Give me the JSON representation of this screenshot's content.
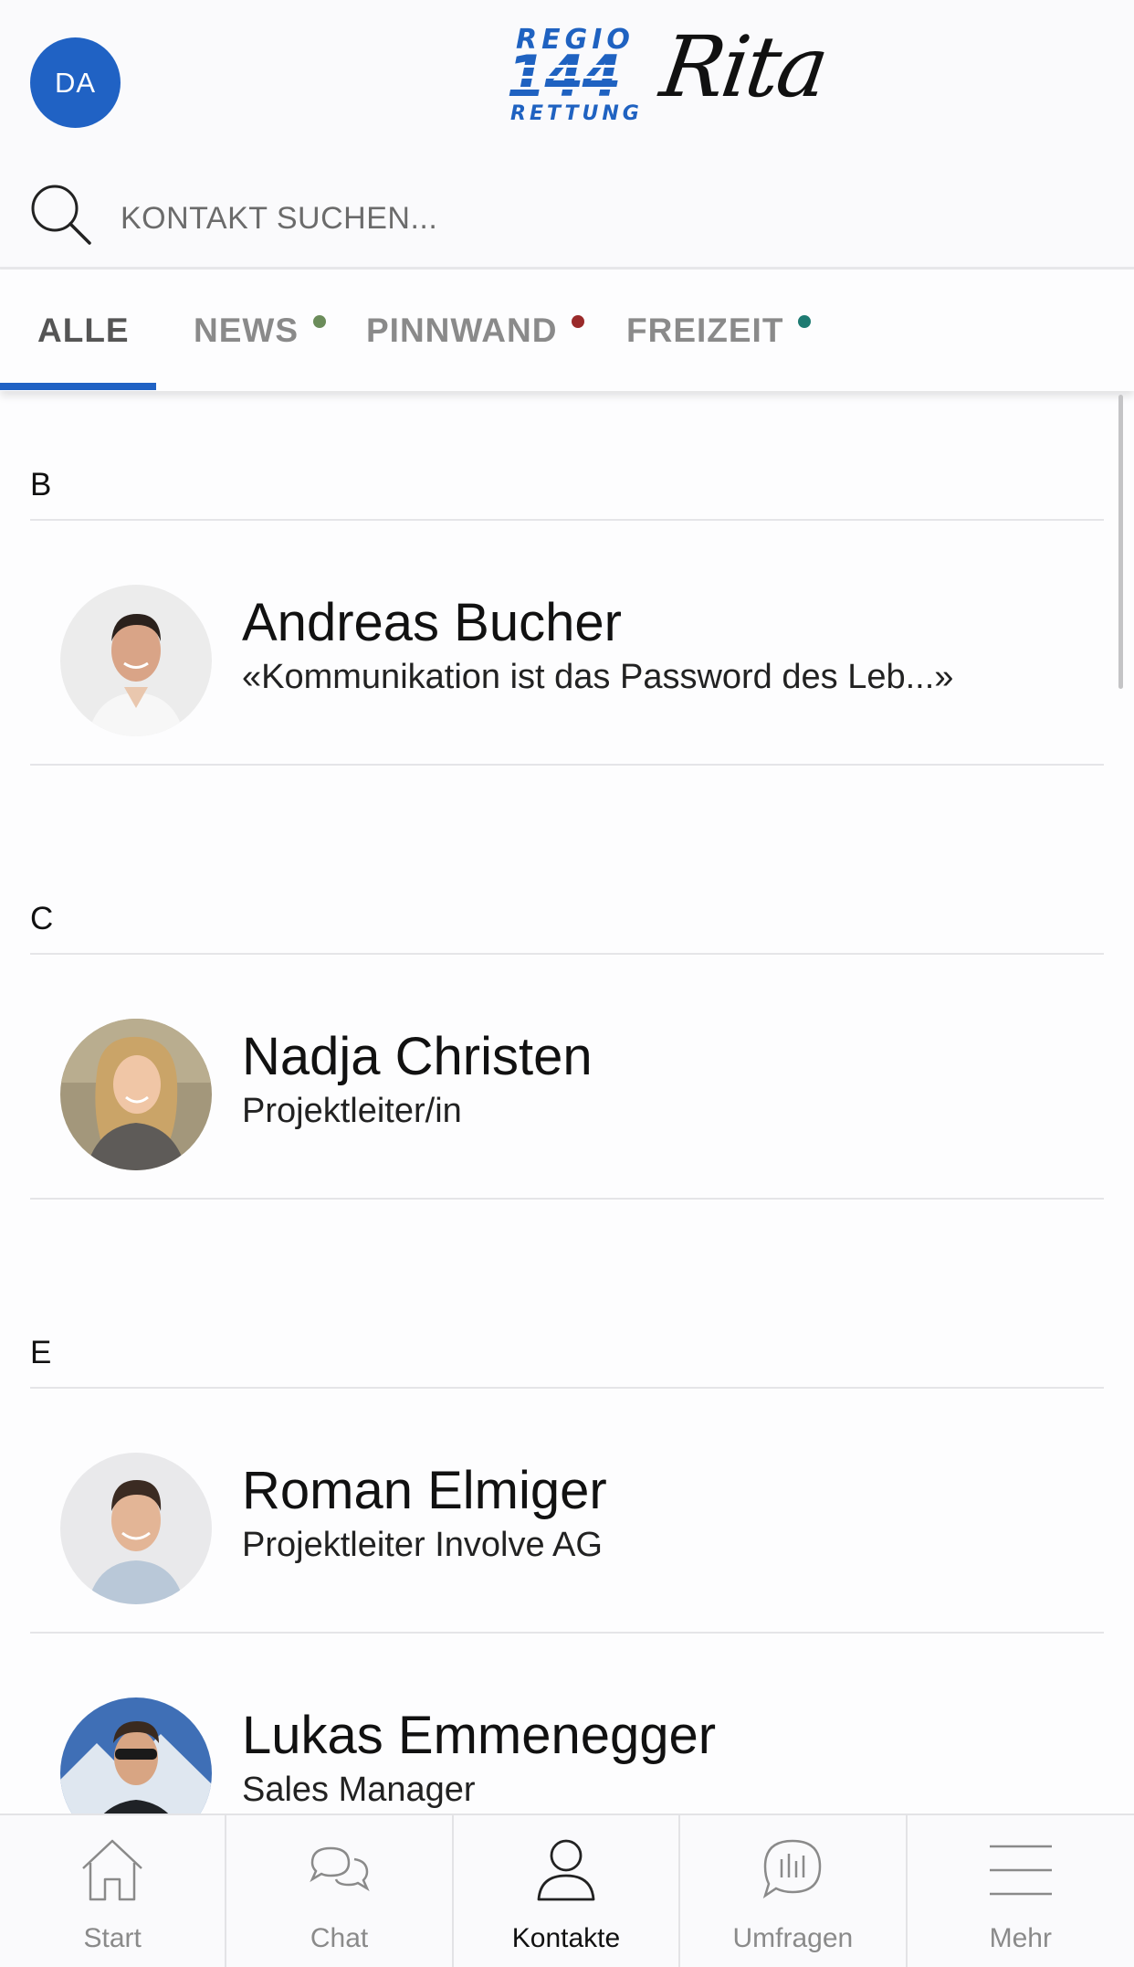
{
  "header": {
    "avatar_initials": "DA",
    "logo": {
      "line1": "REGIO",
      "line2": "144",
      "line3": "RETTUNG",
      "script": "Rita"
    }
  },
  "search": {
    "placeholder": "KONTAKT SUCHEN..."
  },
  "tabs": [
    {
      "label": "ALLE",
      "active": true,
      "dot_color": null
    },
    {
      "label": "NEWS",
      "active": false,
      "dot_color": "#6b8c5a"
    },
    {
      "label": "PINNWAND",
      "active": false,
      "dot_color": "#9a2a2a"
    },
    {
      "label": "FREIZEIT",
      "active": false,
      "dot_color": "#1e7b72"
    }
  ],
  "sections": [
    {
      "letter": "B",
      "contacts": [
        {
          "name": "Andreas Bucher",
          "subtitle": "«Kommunikation ist das Password des Leb...»"
        }
      ]
    },
    {
      "letter": "C",
      "contacts": [
        {
          "name": "Nadja Christen",
          "subtitle": "Projektleiter/in"
        }
      ]
    },
    {
      "letter": "E",
      "contacts": [
        {
          "name": "Roman Elmiger",
          "subtitle": "Projektleiter Involve AG"
        },
        {
          "name": "Lukas Emmenegger",
          "subtitle": "Sales Manager"
        }
      ]
    }
  ],
  "bottom_nav": [
    {
      "label": "Start",
      "icon": "home-icon",
      "active": false
    },
    {
      "label": "Chat",
      "icon": "chat-icon",
      "active": false
    },
    {
      "label": "Kontakte",
      "icon": "contacts-icon",
      "active": true
    },
    {
      "label": "Umfragen",
      "icon": "poll-icon",
      "active": false
    },
    {
      "label": "Mehr",
      "icon": "menu-icon",
      "active": false
    }
  ],
  "colors": {
    "accent": "#2062c4",
    "inactive_text": "#8a8a8a"
  }
}
